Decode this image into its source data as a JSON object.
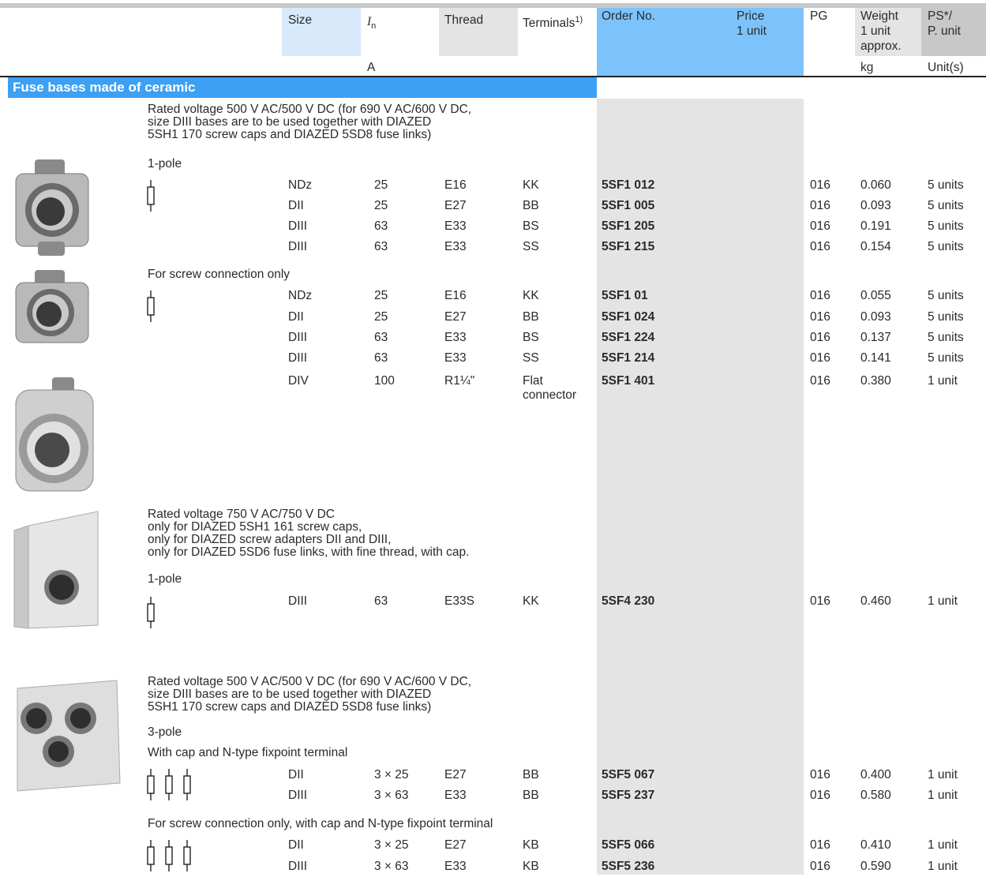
{
  "header": {
    "size": "Size",
    "in": "I",
    "in_sub": "n",
    "thread": "Thread",
    "terminals": "Terminals",
    "terminals_sup": "1)",
    "order": "Order No.",
    "price": "Price\n1 unit",
    "pg": "PG",
    "weight": "Weight\n1 unit\napprox.",
    "ps": "PS*/\nP. unit",
    "unit_in": "A",
    "unit_weight": "kg",
    "unit_ps": "Unit(s)"
  },
  "section_title": "Fuse bases made of ceramic",
  "notes": {
    "rated_1": "Rated voltage 500 V AC/500 V DC (for 690 V AC/600 V DC,\nsize DIII bases are to be used together with DIAZED\n5SH1 170 screw caps and DIAZED 5SD8 fuse links)",
    "pole_1": "1-pole",
    "screw_1": "For screw connection only",
    "rated_2": "Rated voltage 750 V AC/750 V DC\nonly for DIAZED 5SH1 161 screw caps,\nonly for DIAZED screw adapters DII and DIII,\nonly for DIAZED 5SD6 fuse links, with fine thread, with cap.",
    "pole_2": "1-pole",
    "rated_3": "Rated voltage 500 V AC/500 V DC (for 690 V AC/600 V DC,\nsize DIII bases are to be used together with DIAZED\n5SH1 170 screw caps and DIAZED 5SD8 fuse links)",
    "pole_3": "3-pole",
    "cap_3": "With cap and N-type fixpoint terminal",
    "screw_3": "For screw connection only, with cap and N-type fixpoint terminal"
  },
  "rows": [
    {
      "size": "NDz",
      "in": "25",
      "thread": "E16",
      "term": "KK",
      "order": "5SF1 012",
      "pg": "016",
      "w": "0.060",
      "ps": "5 units"
    },
    {
      "size": "DII",
      "in": "25",
      "thread": "E27",
      "term": "BB",
      "order": "5SF1 005",
      "pg": "016",
      "w": "0.093",
      "ps": "5 units"
    },
    {
      "size": "DIII",
      "in": "63",
      "thread": "E33",
      "term": "BS",
      "order": "5SF1 205",
      "pg": "016",
      "w": "0.191",
      "ps": "5 units"
    },
    {
      "size": "DIII",
      "in": "63",
      "thread": "E33",
      "term": "SS",
      "order": "5SF1 215",
      "pg": "016",
      "w": "0.154",
      "ps": "5 units"
    },
    {
      "size": "NDz",
      "in": "25",
      "thread": "E16",
      "term": "KK",
      "order": "5SF1 01",
      "pg": "016",
      "w": "0.055",
      "ps": "5 units"
    },
    {
      "size": "DII",
      "in": "25",
      "thread": "E27",
      "term": "BB",
      "order": "5SF1 024",
      "pg": "016",
      "w": "0.093",
      "ps": "5 units"
    },
    {
      "size": "DIII",
      "in": "63",
      "thread": "E33",
      "term": "BS",
      "order": "5SF1 224",
      "pg": "016",
      "w": "0.137",
      "ps": "5 units"
    },
    {
      "size": "DIII",
      "in": "63",
      "thread": "E33",
      "term": "SS",
      "order": "5SF1 214",
      "pg": "016",
      "w": "0.141",
      "ps": "5 units"
    },
    {
      "size": "DIV",
      "in": "100",
      "thread": "R1¼\"",
      "term": "Flat\nconnector",
      "order": "5SF1 401",
      "pg": "016",
      "w": "0.380",
      "ps": "1 unit"
    },
    {
      "size": "DIII",
      "in": "63",
      "thread": "E33S",
      "term": "KK",
      "order": "5SF4 230",
      "pg": "016",
      "w": "0.460",
      "ps": "1 unit"
    },
    {
      "size": "DII",
      "in": "3 × 25",
      "thread": "E27",
      "term": "BB",
      "order": "5SF5 067",
      "pg": "016",
      "w": "0.400",
      "ps": "1 unit"
    },
    {
      "size": "DIII",
      "in": "3 × 63",
      "thread": "E33",
      "term": "BB",
      "order": "5SF5 237",
      "pg": "016",
      "w": "0.580",
      "ps": "1 unit"
    },
    {
      "size": "DII",
      "in": "3 × 25",
      "thread": "E27",
      "term": "KB",
      "order": "5SF5 066",
      "pg": "016",
      "w": "0.410",
      "ps": "1 unit"
    },
    {
      "size": "DIII",
      "in": "3 × 63",
      "thread": "E33",
      "term": "KB",
      "order": "5SF5 236",
      "pg": "016",
      "w": "0.590",
      "ps": "1 unit"
    }
  ],
  "icons": {
    "fuse_symbol": "fuse-symbol-icon",
    "product_photo": "fuse-base-photo"
  }
}
